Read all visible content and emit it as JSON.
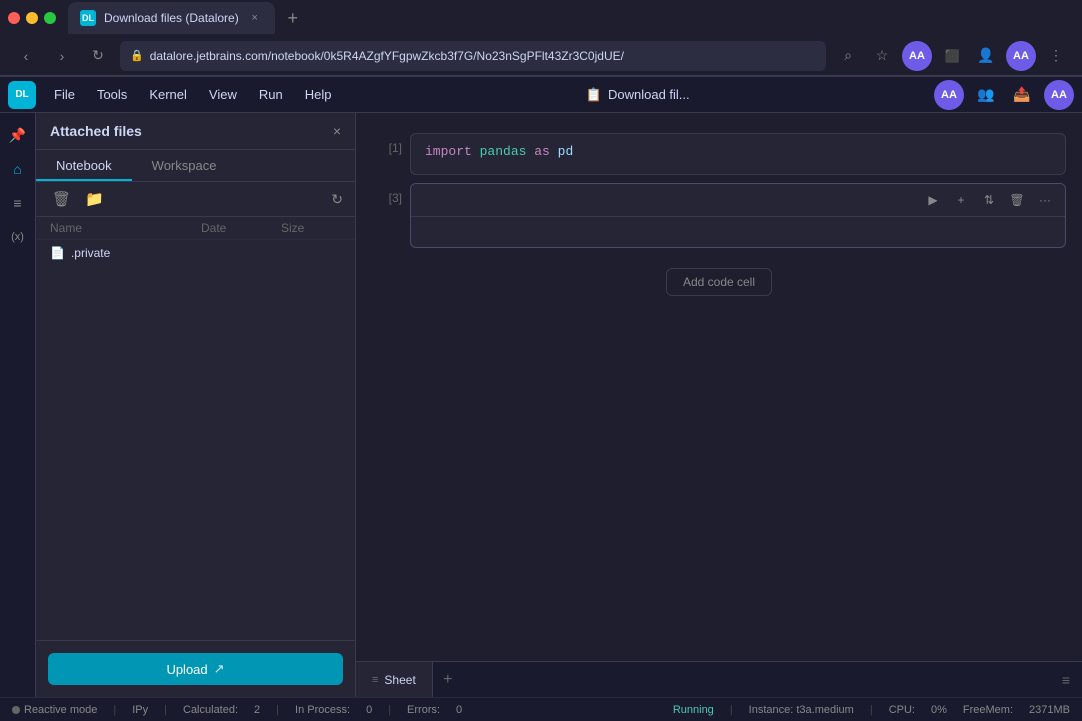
{
  "browser": {
    "tab_favicon": "DL",
    "tab_title": "Download files (Datalore)",
    "tab_close": "×",
    "tab_new": "+",
    "nav_back": "‹",
    "nav_forward": "›",
    "nav_reload": "↻",
    "url": "datalore.jetbrains.com/notebook/0k5R4AZgfYFgpwZkcb3f7G/No23nSgPFlt43Zr3C0jdUE/",
    "url_lock": "🔒",
    "search_icon": "⌕",
    "bookmark_icon": "☆",
    "avatar_text": "AA",
    "ext_icon": "⋮"
  },
  "menubar": {
    "logo": "DL",
    "file": "File",
    "tools": "Tools",
    "kernel": "Kernel",
    "view": "View",
    "run": "Run",
    "help": "Help",
    "notebook_icon": "📋",
    "notebook_title": "Download fil...",
    "avatar_text": "AA"
  },
  "sidebar": {
    "icon_pin": "📌",
    "icon_home": "⌂",
    "icon_list": "≡",
    "icon_var": "(x)"
  },
  "file_panel": {
    "title": "Attached files",
    "close": "×",
    "tab_notebook": "Notebook",
    "tab_workspace": "Workspace",
    "toolbar_delete": "🗑",
    "toolbar_folder": "📁",
    "toolbar_refresh": "↻",
    "col_name": "Name",
    "col_date": "Date",
    "col_size": "Size",
    "files": [
      {
        "icon": "📄",
        "name": ".private",
        "date": "",
        "size": ""
      }
    ],
    "upload_btn": "Upload"
  },
  "notebook": {
    "cells": [
      {
        "number": "[1]",
        "content_html": "<span class='kw'>import</span> <span class='mod'>pandas</span> <span class='alias'>as</span> <span class='alias'>pd</span>",
        "active": false
      },
      {
        "number": "[3]",
        "content_html": "",
        "active": true
      }
    ],
    "add_cell_btn": "Add code cell",
    "cell_run": "▶",
    "cell_add": "+",
    "cell_move": "⇅",
    "cell_delete": "🗑",
    "cell_more": "···"
  },
  "bottom_bar": {
    "sheet_icon": "≡",
    "sheet_label": "Sheet",
    "add_sheet": "+",
    "menu_icon": "≡"
  },
  "status_bar": {
    "reactive_mode": "Reactive mode",
    "separator1": "|",
    "ipy": "IPy",
    "separator2": "|",
    "calculated_label": "Calculated:",
    "calculated_value": "2",
    "separator3": "|",
    "in_process_label": "In Process:",
    "in_process_value": "0",
    "separator4": "|",
    "errors_label": "Errors:",
    "errors_value": "0",
    "running": "Running",
    "instance": "Instance: t3a.medium",
    "cpu": "CPU:",
    "cpu_value": "0%",
    "freemem": "FreeMem:",
    "freemem_value": "2371MB"
  }
}
